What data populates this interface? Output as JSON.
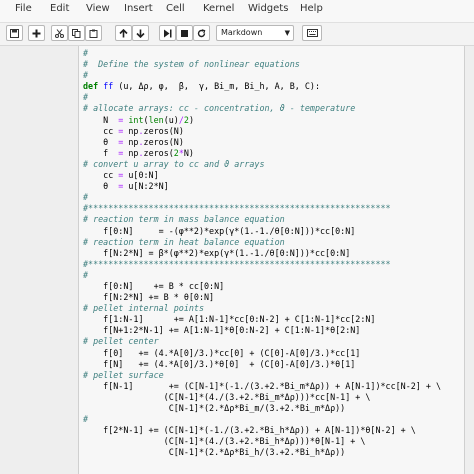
{
  "menu": [
    "File",
    "Edit",
    "View",
    "Insert",
    "Cell",
    "Kernel",
    "Widgets",
    "Help"
  ],
  "toolbar": {
    "cell_type": "Markdown",
    "buttons": [
      "save",
      "add-cell",
      "cut",
      "copy",
      "paste",
      "move-up",
      "move-down",
      "run",
      "stop",
      "restart",
      "command-palette"
    ]
  },
  "code_lines": [
    [
      {
        "t": "#",
        "s": "c"
      }
    ],
    [
      {
        "t": "#  Define the system of nonlinear equations",
        "s": "c"
      }
    ],
    [
      {
        "t": "#",
        "s": "c"
      }
    ],
    [
      {
        "t": "def",
        "s": "k"
      },
      {
        "t": " "
      },
      {
        "t": "ff",
        "s": "f"
      },
      {
        "t": " (u, Δρ, φ,  β,  γ, Bi_m, Bi_h, A, B, C):"
      }
    ],
    [
      {
        "t": "#",
        "s": "c"
      }
    ],
    [
      {
        "t": "# allocate arrays: cc - concentration, ϑ - temperature",
        "s": "c"
      }
    ],
    [
      {
        "t": "    N  "
      },
      {
        "t": "=",
        "s": "o"
      },
      {
        "t": " "
      },
      {
        "t": "int",
        "s": "b"
      },
      {
        "t": "("
      },
      {
        "t": "len",
        "s": "b"
      },
      {
        "t": "(u)"
      },
      {
        "t": "/",
        "s": "o"
      },
      {
        "t": "2",
        "s": "n"
      },
      {
        "t": ")"
      }
    ],
    [
      {
        "t": "    cc "
      },
      {
        "t": "=",
        "s": "o"
      },
      {
        "t": " np"
      },
      {
        "t": ".",
        "s": "o"
      },
      {
        "t": "zeros(N)"
      }
    ],
    [
      {
        "t": "    θ  "
      },
      {
        "t": "=",
        "s": "o"
      },
      {
        "t": " np"
      },
      {
        "t": ".",
        "s": "o"
      },
      {
        "t": "zeros(N)"
      }
    ],
    [
      {
        "t": "    f  "
      },
      {
        "t": "=",
        "s": "o"
      },
      {
        "t": " np"
      },
      {
        "t": ".",
        "s": "o"
      },
      {
        "t": "zeros("
      },
      {
        "t": "2",
        "s": "n"
      },
      {
        "t": "*",
        "s": "o"
      },
      {
        "t": "N)"
      }
    ],
    [
      {
        "t": "# convert u array to cc and ϑ arrays",
        "s": "c"
      }
    ],
    [
      {
        "t": "    cc "
      },
      {
        "t": "=",
        "s": "o"
      },
      {
        "t": " u[0:N]"
      }
    ],
    [
      {
        "t": "    θ  "
      },
      {
        "t": "=",
        "s": "o"
      },
      {
        "t": " u[N:2*N]"
      }
    ],
    [
      {
        "t": "#",
        "s": "c"
      }
    ],
    [
      {
        "t": "#************************************************************",
        "s": "c"
      }
    ],
    [
      {
        "t": "# reaction term in mass balance equation",
        "s": "c"
      }
    ],
    [
      {
        "t": "    f[0:N]     = -(φ**2)*exp(γ*(1.-1./θ[0:N]))*cc[0:N]"
      }
    ],
    [
      {
        "t": "# reaction term in heat balance equation",
        "s": "c"
      }
    ],
    [
      {
        "t": "    f[N:2*N] = β*(φ**2)*exp(γ*(1.-1./θ[0:N]))*cc[0:N]"
      }
    ],
    [
      {
        "t": "#************************************************************",
        "s": "c"
      }
    ],
    [
      {
        "t": "#",
        "s": "c"
      }
    ],
    [
      {
        "t": "    f[0:N]    += B * cc[0:N]"
      }
    ],
    [
      {
        "t": "    f[N:2*N] += B * θ[0:N]"
      }
    ],
    [
      {
        "t": "# pellet internal points",
        "s": "c"
      }
    ],
    [
      {
        "t": "    f[1:N-1]      += A[1:N-1]*cc[0:N-2] + C[1:N-1]*cc[2:N]"
      }
    ],
    [
      {
        "t": "    f[N+1:2*N-1] += A[1:N-1]*θ[0:N-2] + C[1:N-1]*θ[2:N]"
      }
    ],
    [
      {
        "t": "# pellet center",
        "s": "c"
      }
    ],
    [
      {
        "t": "    f[0]   += (4.*A[0]/3.)*cc[0] + (C[0]-A[0]/3.)*cc[1]"
      }
    ],
    [
      {
        "t": "    f[N]   += (4.*A[0]/3.)*θ[0]  + (C[0]-A[0]/3.)*θ[1]"
      }
    ],
    [
      {
        "t": "# pellet surface",
        "s": "c"
      }
    ],
    [
      {
        "t": "    f[N-1]       += (C[N-1]*(-1./(3.+2.*Bi_m*Δρ)) + A[N-1])*cc[N-2] + \\"
      }
    ],
    [
      {
        "t": "                (C[N-1]*(4./(3.+2.*Bi_m*Δρ)))*cc[N-1] + \\"
      }
    ],
    [
      {
        "t": "                 C[N-1]*(2.*Δρ*Bi_m/(3.+2.*Bi_m*Δρ))"
      }
    ],
    [
      {
        "t": "#",
        "s": "c"
      }
    ],
    [
      {
        "t": "    f[2*N-1] += (C[N-1]*(-1./(3.+2.*Bi_h*Δρ)) + A[N-1])*θ[N-2] + \\"
      }
    ],
    [
      {
        "t": "                (C[N-1]*(4./(3.+2.*Bi_h*Δρ)))*θ[N-1] + \\"
      }
    ],
    [
      {
        "t": "                 C[N-1]*(2.*Δρ*Bi_h/(3.+2.*Bi_h*Δρ))"
      }
    ]
  ]
}
